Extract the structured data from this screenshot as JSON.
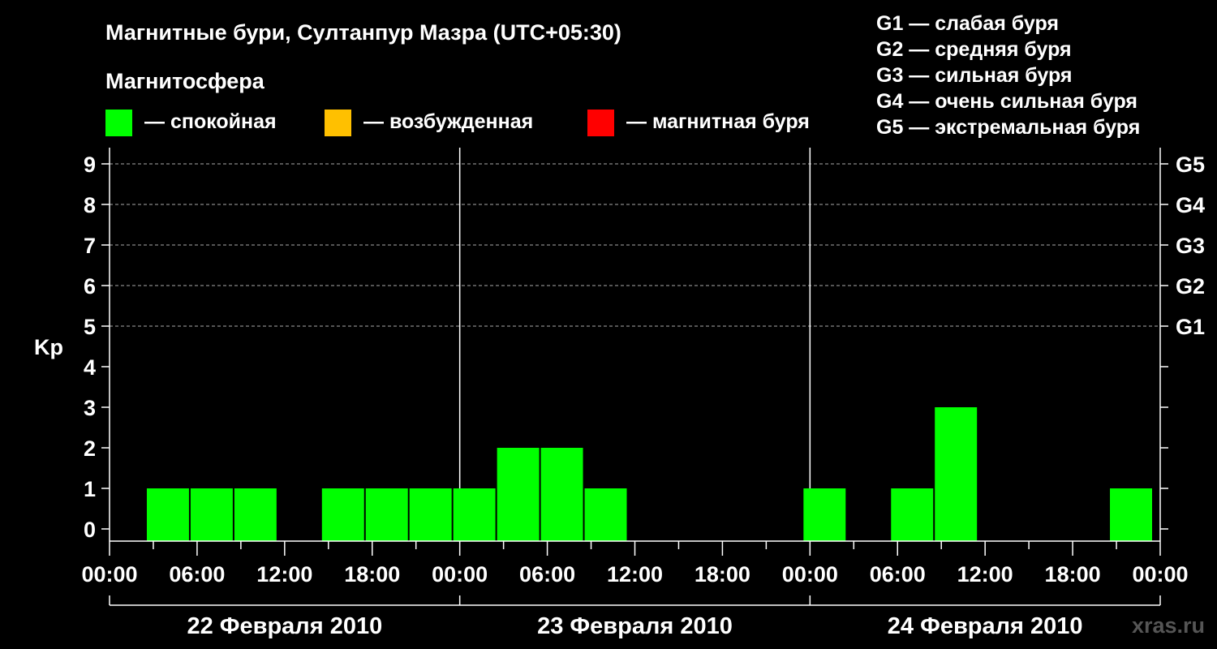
{
  "chart_data": {
    "type": "bar",
    "title": "Магнитные бури, Султанпур Мазра (UTC+05:30)",
    "legend_title": "Магнитосфера",
    "legend": [
      {
        "label": "— спокойная",
        "color": "#00ff00"
      },
      {
        "label": "— возбужденная",
        "color": "#ffc000"
      },
      {
        "label": "— магнитная буря",
        "color": "#ff0000"
      }
    ],
    "storm_levels": [
      "G1 — слабая буря",
      "G2 — средняя буря",
      "G3 — сильная буря",
      "G4 — очень сильная буря",
      "G5 — экстремальная буря"
    ],
    "ylabel": "Kp",
    "ylim": [
      0,
      9
    ],
    "yticks": [
      0,
      1,
      2,
      3,
      4,
      5,
      6,
      7,
      8,
      9
    ],
    "right_ticks": [
      {
        "kp": 5,
        "label": "G1"
      },
      {
        "kp": 6,
        "label": "G2"
      },
      {
        "kp": 7,
        "label": "G3"
      },
      {
        "kp": 8,
        "label": "G4"
      },
      {
        "kp": 9,
        "label": "G5"
      }
    ],
    "xlim_hours": [
      0,
      72
    ],
    "xticks": [
      {
        "hour": 0,
        "label": "00:00"
      },
      {
        "hour": 6,
        "label": "06:00"
      },
      {
        "hour": 12,
        "label": "12:00"
      },
      {
        "hour": 18,
        "label": "18:00"
      },
      {
        "hour": 24,
        "label": "00:00"
      },
      {
        "hour": 30,
        "label": "06:00"
      },
      {
        "hour": 36,
        "label": "12:00"
      },
      {
        "hour": 42,
        "label": "18:00"
      },
      {
        "hour": 48,
        "label": "00:00"
      },
      {
        "hour": 54,
        "label": "06:00"
      },
      {
        "hour": 60,
        "label": "12:00"
      },
      {
        "hour": 66,
        "label": "18:00"
      },
      {
        "hour": 72,
        "label": "00:00"
      }
    ],
    "days": [
      "22 Февраля 2010",
      "23 Февраля 2010",
      "24 Февраля 2010"
    ],
    "bars": [
      {
        "start": 2.5,
        "kp": 1
      },
      {
        "start": 5.5,
        "kp": 1
      },
      {
        "start": 8.5,
        "kp": 1
      },
      {
        "start": 11.5,
        "kp": 0
      },
      {
        "start": 14.5,
        "kp": 1
      },
      {
        "start": 17.5,
        "kp": 1
      },
      {
        "start": 20.5,
        "kp": 1
      },
      {
        "start": 23.5,
        "kp": 1
      },
      {
        "start": 26.5,
        "kp": 2
      },
      {
        "start": 29.5,
        "kp": 2
      },
      {
        "start": 32.5,
        "kp": 1
      },
      {
        "start": 35.5,
        "kp": 0
      },
      {
        "start": 38.5,
        "kp": 0
      },
      {
        "start": 41.5,
        "kp": 0
      },
      {
        "start": 44.5,
        "kp": 0
      },
      {
        "start": 47.5,
        "kp": 1
      },
      {
        "start": 50.5,
        "kp": 0
      },
      {
        "start": 53.5,
        "kp": 1
      },
      {
        "start": 56.5,
        "kp": 3
      },
      {
        "start": 59.5,
        "kp": 0
      },
      {
        "start": 62.5,
        "kp": 0
      },
      {
        "start": 65.5,
        "kp": 0
      },
      {
        "start": 68.5,
        "kp": 1
      }
    ],
    "bar_hours": 3,
    "grid_dashed_from_kp": 5
  },
  "watermark": "xras.ru"
}
